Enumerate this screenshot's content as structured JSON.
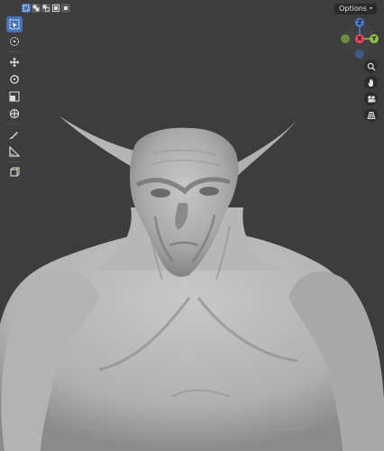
{
  "header": {
    "options_label": "Options"
  },
  "gizmo": {
    "z_label": "Z",
    "x_label": "X",
    "y_label": "Y",
    "colors": {
      "x": "#e84a5f",
      "y": "#8bc34a",
      "z": "#4b7bd6",
      "neg": "#3d5a8a"
    }
  },
  "toolbar": {
    "tools": [
      "select-box-icon",
      "cursor-icon",
      "move-icon",
      "rotate-icon",
      "scale-icon",
      "transform-icon",
      "annotate-icon",
      "measure-icon",
      "add-cube-icon"
    ]
  },
  "navigation": {
    "buttons": [
      "zoom-icon",
      "pan-hand-icon",
      "camera-icon",
      "perspective-grid-icon"
    ]
  },
  "accent_color": "#4772b3"
}
